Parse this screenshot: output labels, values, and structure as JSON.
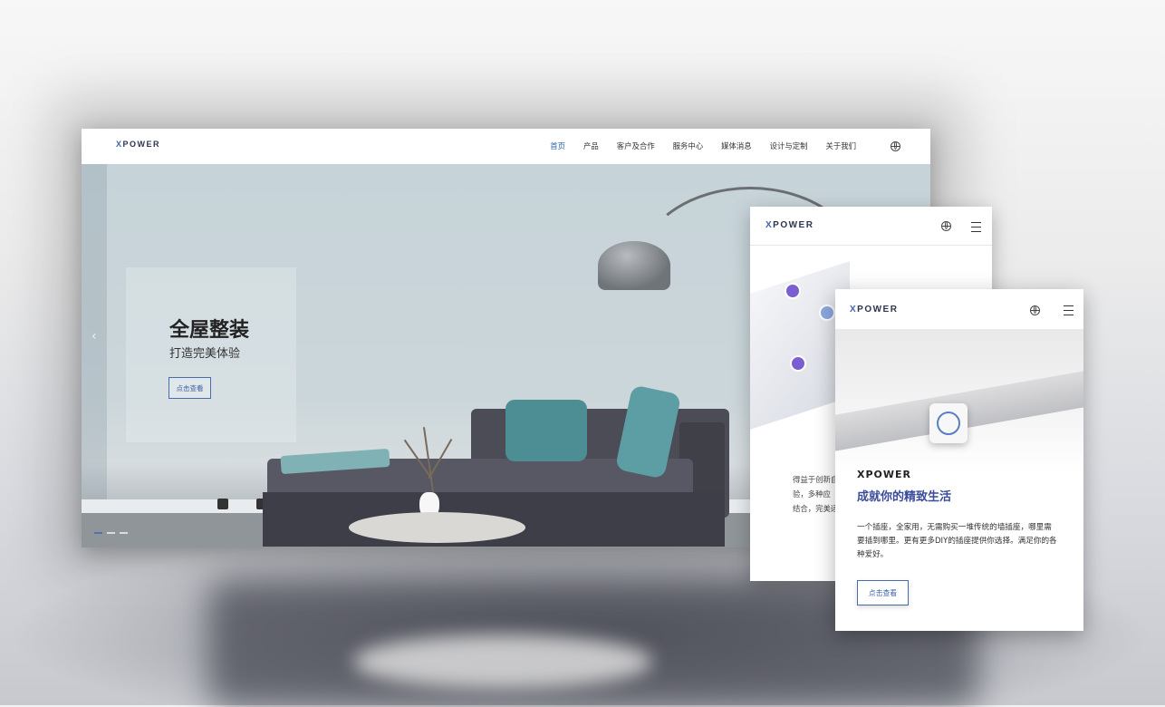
{
  "brand": {
    "logo_text": "XPOWER",
    "logo_x": "X",
    "logo_rest": "POWER"
  },
  "desktop": {
    "nav": [
      "首页",
      "产品",
      "客户及合作",
      "服务中心",
      "媒体消息",
      "设计与定制",
      "关于我们"
    ],
    "active_nav": "首页",
    "hero": {
      "title": "全屋整装",
      "subtitle": "打造完美体验",
      "button": "点击查看",
      "prev_arrow": "‹",
      "slide_count": 3,
      "current_slide": 1
    }
  },
  "tablet": {
    "text_lines": [
      "得益于创新自",
      "验，多种应",
      "结合，完美适"
    ]
  },
  "phone": {
    "brand": "XPOWER",
    "title": "成就你的精致生活",
    "description": "一个插座，全家用，无需购买一堆传统的墙插座，哪里需要插到哪里。更有更多DIY的插座提供你选择。满足你的各种爱好。",
    "button": "点击查看"
  },
  "colors": {
    "accent": "#2f64ad",
    "title_blue": "#3a4c9a",
    "sofa": "#4b4c55",
    "pillow": "#4c8e94"
  },
  "icons": [
    "globe-icon",
    "menu-icon",
    "chevron-left-icon"
  ]
}
